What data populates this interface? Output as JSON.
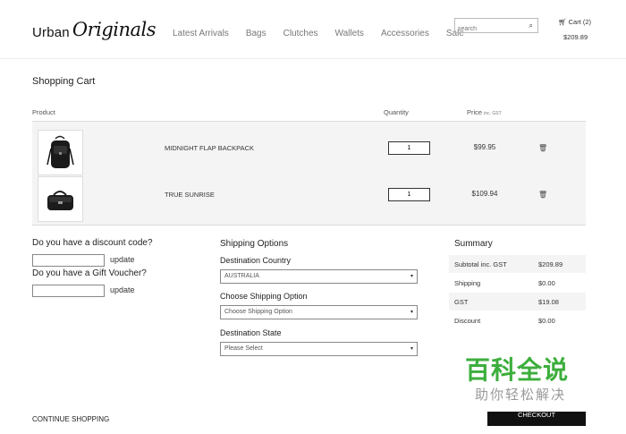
{
  "header": {
    "logo_word": "Urban",
    "logo_script": "Originals",
    "nav": [
      "Latest Arrivals",
      "Bags",
      "Clutches",
      "Wallets",
      "Accessories",
      "Sale"
    ],
    "search_placeholder": "search",
    "cart_label": "Cart (2)",
    "cart_total": "$209.89"
  },
  "page_title": "Shopping Cart",
  "table_headers": {
    "product": "Product",
    "quantity": "Quantity",
    "price": "Price",
    "price_note": "inc. GST"
  },
  "items": [
    {
      "name": "MIDNIGHT FLAP BACKPACK",
      "qty": "1",
      "price": "$99.95"
    },
    {
      "name": "TRUE SUNRISE",
      "qty": "1",
      "price": "$109.94"
    }
  ],
  "discount": {
    "question": "Do you have a discount code?",
    "update": "update"
  },
  "voucher": {
    "question": "Do you have a Gift Voucher?",
    "update": "update"
  },
  "shipping": {
    "title": "Shipping Options",
    "country_label": "Destination Country",
    "country_value": "AUSTRALIA",
    "option_label": "Choose Shipping Option",
    "option_value": "Choose Shipping Option",
    "state_label": "Destination State",
    "state_value": "Please Select"
  },
  "summary": {
    "title": "Summary",
    "rows": [
      {
        "label": "Subtotal inc. GST",
        "value": "$209.89"
      },
      {
        "label": "Shipping",
        "value": "$0.00"
      },
      {
        "label": "GST",
        "value": "$19.08"
      },
      {
        "label": "Discount",
        "value": "$0.00"
      }
    ]
  },
  "footer": {
    "continue": "CONTINUE SHOPPING",
    "checkout": "CHECKOUT"
  },
  "watermark": {
    "main": "百科全说",
    "sub": "助你轻松解决"
  }
}
